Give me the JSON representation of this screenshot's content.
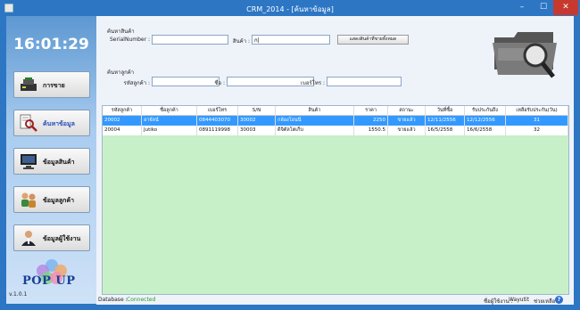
{
  "window": {
    "title": "CRM_2014 - [ค้นหาข้อมูล]",
    "min": "–",
    "max": "☐",
    "close": "✕"
  },
  "sidebar": {
    "clock": "16:01:29",
    "items": [
      {
        "label": "การขาย",
        "icon": "sales-icon"
      },
      {
        "label": "ค้นหาข้อมูล",
        "icon": "search-doc-icon"
      },
      {
        "label": "ข้อมูลสินค้า",
        "icon": "monitor-icon"
      },
      {
        "label": "ข้อมูลลูกค้า",
        "icon": "customers-icon"
      },
      {
        "label": "ข้อมูลผู้ใช้งาน",
        "icon": "user-icon"
      }
    ],
    "logo_text": "POP UP",
    "version": "v.1.0.1"
  },
  "search": {
    "product_section": "ค้นหาสินค้า",
    "serial_label": "SerialNumber :",
    "serial_value": "",
    "product_label": "สินค้า :",
    "product_value": "ก|",
    "show_all_button": "แสดงสินค้าที่ขายทั้งหมด",
    "customer_section": "ค้นหาลูกค้า",
    "cust_id_label": "รหัสลูกค้า :",
    "cust_id_value": "",
    "name_label": "ชื่อ :",
    "name_value": "",
    "phone_label": "เบอร์โทร :",
    "phone_value": ""
  },
  "grid": {
    "columns": [
      "รหัสลูกค้า",
      "ชื่อลูกค้า",
      "เบอร์โทร",
      "S/N",
      "สินค้า",
      "ราคา",
      "สถานะ",
      "วันที่ซื้อ",
      "รับประกันถึง",
      "เหลือรับประกัน(วัน)"
    ],
    "rows": [
      [
        "20002",
        "อาจัลน์",
        "0844403070",
        "30002",
        "กล้องโอนนี",
        "2250",
        "ขายแล้ว",
        "12/11/2556",
        "12/12/2556",
        "31"
      ],
      [
        "20004",
        "Jutiko",
        "0891119998",
        "30003",
        "ดิจิตัลโตเก็บ",
        "1550.5",
        "ขายแล้ว",
        "16/5/2558",
        "16/6/2558",
        "32"
      ]
    ]
  },
  "status": {
    "db_label": "Database :",
    "db_value": "Connected",
    "user_label": "ชื่อผู้ใช้งาน :",
    "user_value": "Wayutit",
    "help_label": "ช่วยเหลือ",
    "help_glyph": "?"
  }
}
